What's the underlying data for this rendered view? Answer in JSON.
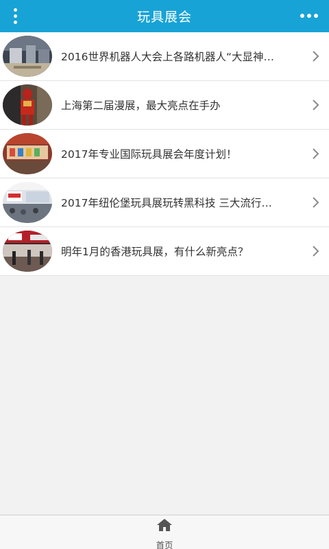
{
  "header": {
    "title": "玩具展会",
    "left_icon": "vertical-dots-menu-icon",
    "right_icon": "horizontal-dots-more-icon",
    "bg_color": "#18a3d6"
  },
  "list": {
    "items": [
      {
        "title": "2016世界机器人大会上各路机器人“大显神…",
        "thumb": "robot-conference-photo"
      },
      {
        "title": "上海第二届漫展，最大亮点在手办",
        "thumb": "iron-man-figure-photo"
      },
      {
        "title": "2017年专业国际玩具展会年度计划！",
        "thumb": "toy-fair-booth-photo"
      },
      {
        "title": "2017年纽伦堡玩具展玩转黑科技 三大流行…",
        "thumb": "nuremberg-toy-fair-photo"
      },
      {
        "title": "明年1月的香港玩具展，有什么新亮点？",
        "thumb": "hong-kong-toy-fair-photo"
      }
    ]
  },
  "footer": {
    "home_label": "首页",
    "home_icon": "home-icon"
  }
}
